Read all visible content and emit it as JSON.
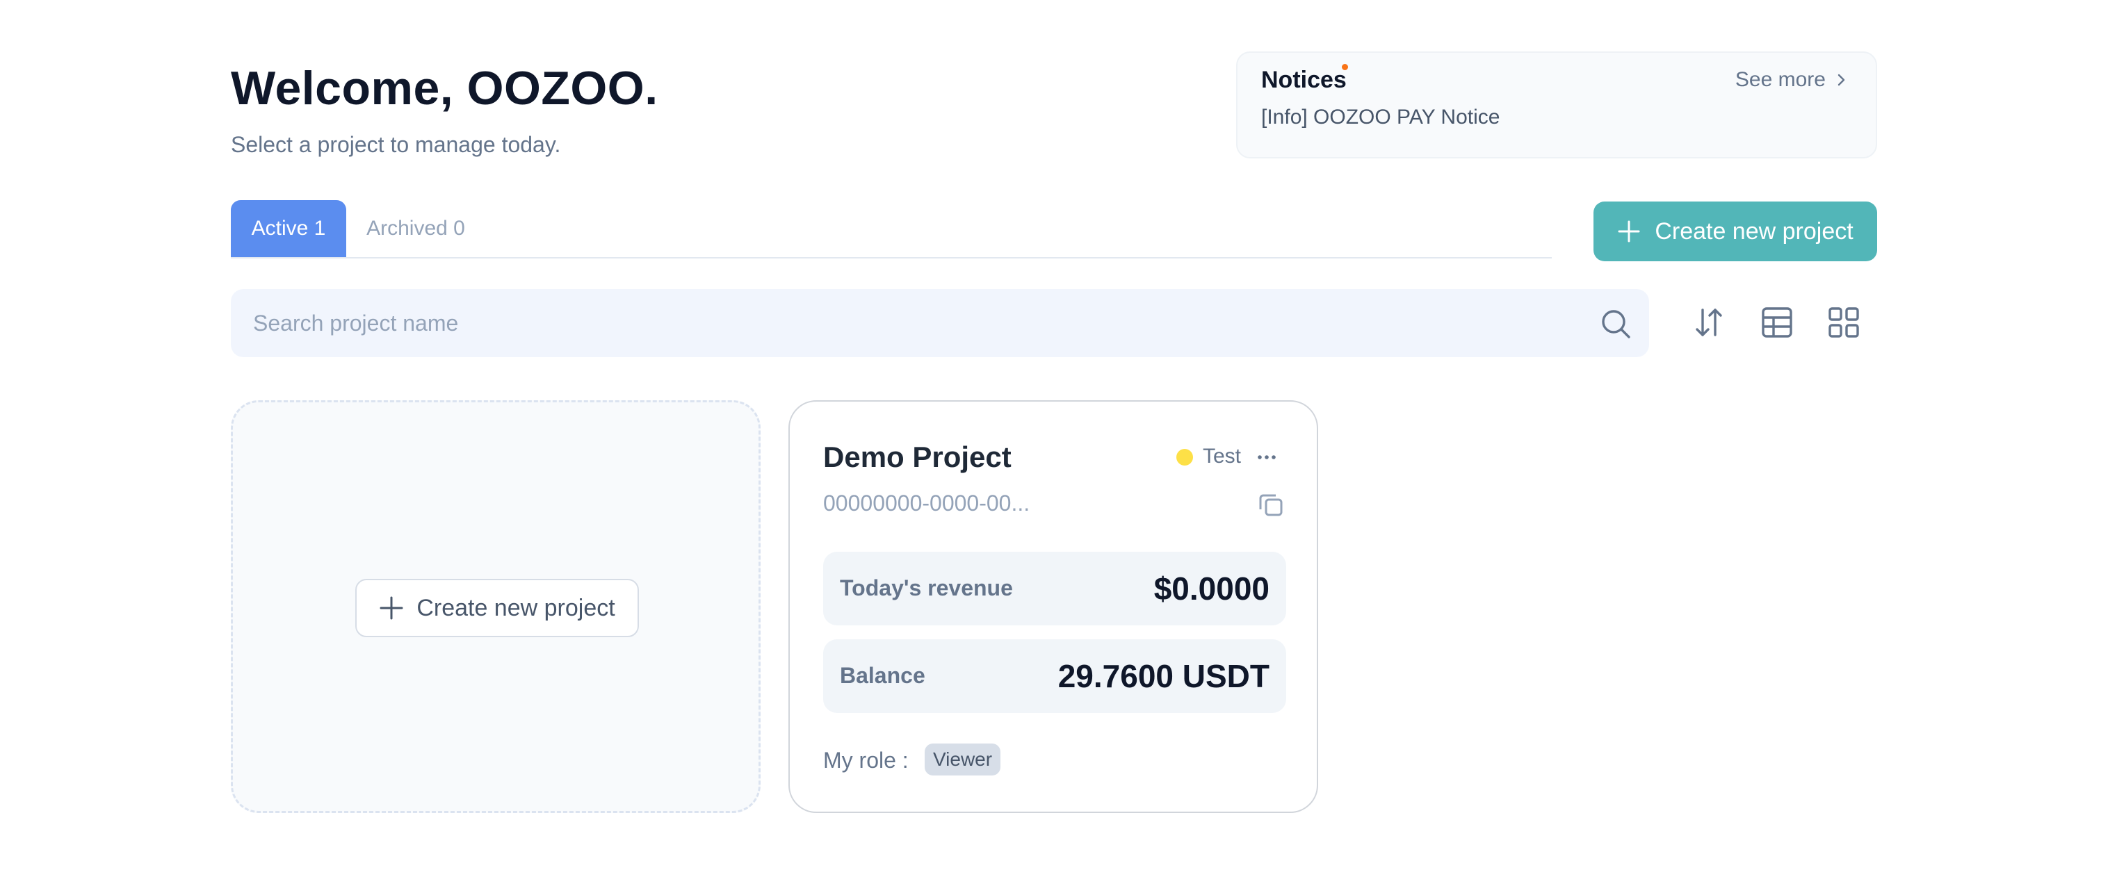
{
  "header": {
    "title": "Welcome, OOZOO.",
    "subtitle": "Select a project to manage today."
  },
  "notices": {
    "title": "Notices",
    "see_more": "See more",
    "items": [
      "[Info] OOZOO PAY Notice"
    ],
    "dot_color": "#f97316"
  },
  "tabs": [
    {
      "label": "Active 1",
      "active": true
    },
    {
      "label": "Archived 0",
      "active": false
    }
  ],
  "create_button": {
    "label": "Create new project",
    "color": "#52b6b8"
  },
  "search": {
    "placeholder": "Search project name",
    "value": ""
  },
  "toolbar": {
    "icons": [
      "sort-icon",
      "table-view-icon",
      "grid-view-icon"
    ]
  },
  "new_project_card": {
    "label": "Create new project"
  },
  "project_card": {
    "name": "Demo Project",
    "status": "Test",
    "status_color": "#fde047",
    "id": "00000000-0000-00...",
    "revenue_label": "Today's revenue",
    "revenue_value": "$0.0000",
    "balance_label": "Balance",
    "balance_value": "29.7600 USDT",
    "role_label": "My role :",
    "role": "Viewer"
  },
  "colors": {
    "accent_blue": "#5b8def",
    "accent_teal": "#52b6b8",
    "text_dark": "#0f172a",
    "text_muted": "#64748b"
  }
}
